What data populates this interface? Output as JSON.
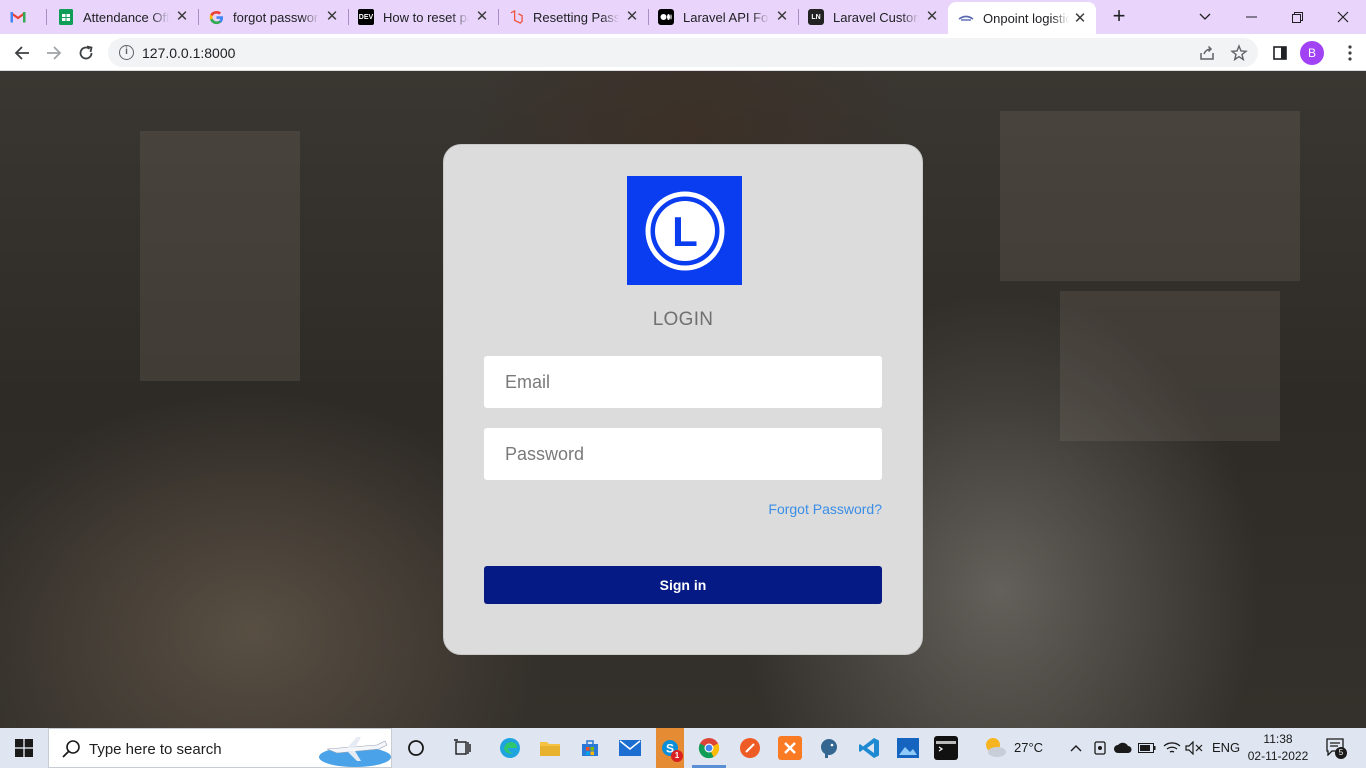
{
  "browser": {
    "tabs": [
      {
        "title": "",
        "icon": "gmail-icon"
      },
      {
        "title": "Attendance Offi",
        "icon": "sheets-icon"
      },
      {
        "title": "forgot password",
        "icon": "google-icon"
      },
      {
        "title": "How to reset pa",
        "icon": "dev-icon"
      },
      {
        "title": "Resetting Passw",
        "icon": "laravel-icon"
      },
      {
        "title": "Laravel API Forg",
        "icon": "medium-icon"
      },
      {
        "title": "Laravel Custom",
        "icon": "laravel-news-icon"
      },
      {
        "title": "Onpoint logistic",
        "icon": "onpoint-icon"
      }
    ],
    "url": "127.0.0.1:8000",
    "profile_initial": "B",
    "accent": "#e9d5fb"
  },
  "login": {
    "logo_letter": "L",
    "title": "LOGIN",
    "email_placeholder": "Email",
    "password_placeholder": "Password",
    "forgot_label": "Forgot Password?",
    "signin_label": "Sign in",
    "button_color": "#061a86",
    "logo_color": "#0a3cf0"
  },
  "taskbar": {
    "search_placeholder": "Type here to search",
    "weather": "27°C",
    "language": "ENG",
    "time": "11:38",
    "date": "02-11-2022",
    "notification_count": "5",
    "skype_badge": "1"
  }
}
